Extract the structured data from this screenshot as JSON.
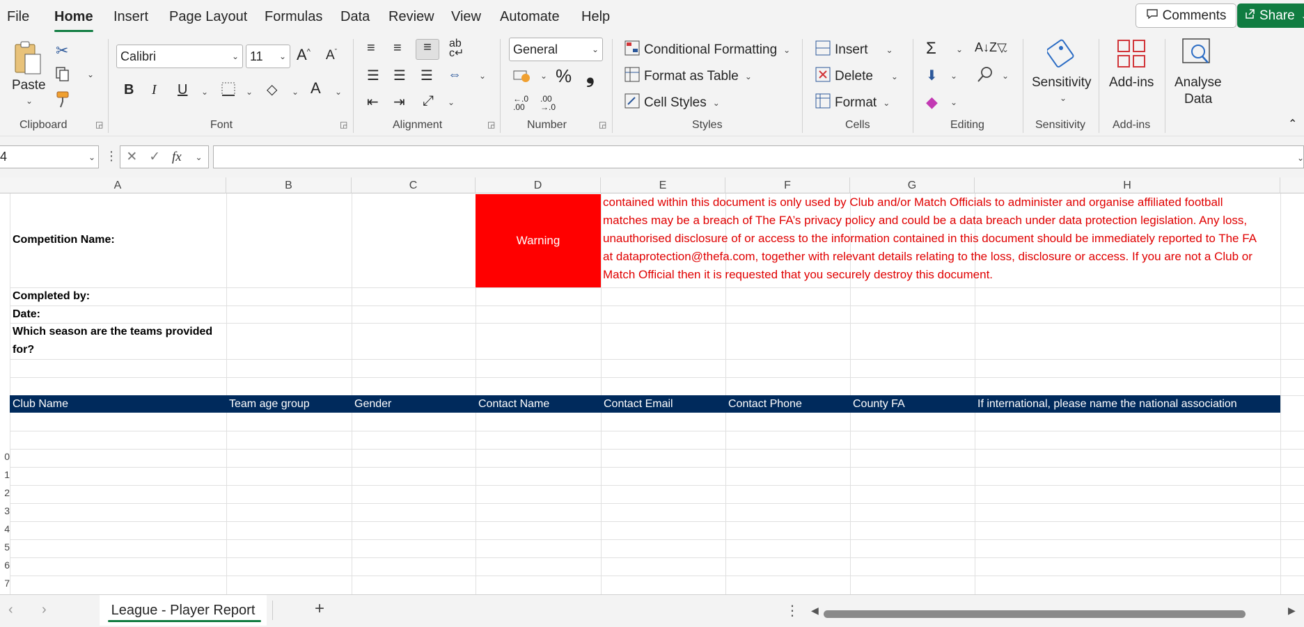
{
  "menu": {
    "items": [
      "File",
      "Home",
      "Insert",
      "Page Layout",
      "Formulas",
      "Data",
      "Review",
      "View",
      "Automate",
      "Help"
    ],
    "comments_label": "Comments",
    "share_label": "Share"
  },
  "ribbon": {
    "clipboard": {
      "paste_label": "Paste",
      "group_label": "Clipboard"
    },
    "font": {
      "font_name": "Calibri",
      "font_size": "11",
      "group_label": "Font"
    },
    "alignment": {
      "group_label": "Alignment"
    },
    "number": {
      "format": "General",
      "percent_symbol": "%",
      "comma_symbol": "❟",
      "group_label": "Number"
    },
    "styles": {
      "conditional_formatting": "Conditional Formatting",
      "format_as_table": "Format as Table",
      "cell_styles": "Cell Styles",
      "group_label": "Styles"
    },
    "cells": {
      "insert": "Insert",
      "delete": "Delete",
      "format": "Format",
      "group_label": "Cells"
    },
    "editing": {
      "group_label": "Editing"
    },
    "sensitivity": {
      "button_label": "Sensitivity",
      "group_label": "Sensitivity"
    },
    "addins": {
      "button_label": "Add-ins",
      "group_label": "Add-ins"
    },
    "analyse": {
      "line1": "Analyse",
      "line2": "Data"
    }
  },
  "formula_bar": {
    "name_box": "4",
    "fx": "fx",
    "formula": ""
  },
  "grid": {
    "columns": [
      "A",
      "B",
      "C",
      "D",
      "E",
      "F",
      "G",
      "H"
    ],
    "row_numbers": [
      "0",
      "1",
      "2",
      "3",
      "4",
      "5",
      "6",
      "7"
    ],
    "labels": {
      "competition_name": "Competition Name:",
      "completed_by": "Completed by:",
      "date": "Date:",
      "season_line1": "Which season are the teams provided",
      "season_line2": "for?"
    },
    "warning_label": "Warning",
    "warning_lines": [
      "contained within this document is only used by Club and/or Match Officials to administer and organise affiliated football",
      "matches may be a breach of The FA’s privacy policy and could be a data breach under data protection legislation. Any loss,",
      "unauthorised disclosure of or access to the information contained in this document should be immediately reported to The FA",
      "at dataprotection@thefa.com, together with relevant details relating to the loss, disclosure or access. If you are not a Club or",
      "Match Official then it is requested that you securely destroy this document."
    ],
    "table_headers": [
      "Club Name",
      "Team age group",
      "Gender",
      "Contact Name",
      "Contact Email",
      "Contact Phone",
      "County FA",
      "If international, please name the national association"
    ],
    "header_band_color": "#002a5c",
    "warning_color": "#ff0000"
  },
  "sheet_tabs": {
    "active": "League - Player Report",
    "add_symbol": "+"
  },
  "colors": {
    "accent": "#107c41",
    "warning_text": "#e00000"
  }
}
